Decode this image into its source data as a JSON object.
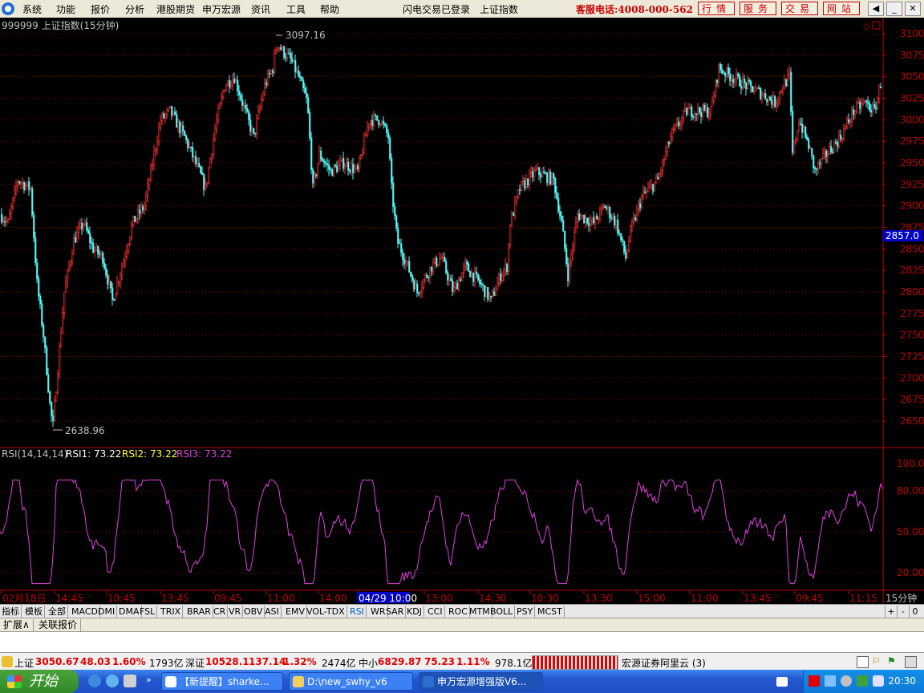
{
  "menu": {
    "items": [
      "系统",
      "功能",
      "报价",
      "分析",
      "港股期货",
      "申万宏源",
      "资讯",
      "工具",
      "帮助"
    ],
    "status_login": "闪电交易已登录",
    "status_index": "上证指数",
    "hotline": "客服电话:4008-000-562",
    "buttons": [
      "行情",
      "服务",
      "交易",
      "网站"
    ]
  },
  "main_chart": {
    "title": "999999 上证指数(15分钟)",
    "max_label": "3097.16",
    "min_label": "2638.96",
    "current_price": "2857.0",
    "y_ticks": [
      3100,
      3075,
      3050,
      3025,
      3000,
      2975,
      2950,
      2925,
      2900,
      2875,
      2850,
      2825,
      2800,
      2775,
      2750,
      2725,
      2700,
      2675,
      2650
    ]
  },
  "rsi": {
    "label": "RSI(14,14,14)",
    "rsi1": "RSI1: 73.22",
    "rsi2": "RSI2: 73.22",
    "rsi3": "RSI3: 73.22",
    "y_ticks": [
      "100.00",
      "80.00",
      "50.00",
      "20.00"
    ]
  },
  "time_axis": {
    "labels": [
      "02月18日",
      "14:45",
      "10:45",
      "13:45",
      "09:45",
      "11:00",
      "14:00",
      "04/29 10:00",
      "13:00",
      "14:30",
      "10:30",
      "13:30",
      "15:00",
      "11:00",
      "13:45",
      "09:45",
      "11:15"
    ],
    "period": "15分钟"
  },
  "indicator_tabs": [
    "指标",
    "模板",
    "全部",
    "MACD",
    "DMI",
    "DMA",
    "FSL",
    "TRIX",
    "BRAR",
    "CR",
    "VR",
    "OBV",
    "ASI",
    "EMV",
    "VOL-TDX",
    "RSI",
    "WR",
    "SAR",
    "KDJ",
    "CCI",
    "ROC",
    "MTM",
    "BOLL",
    "PSY",
    "MCST"
  ],
  "active_indicator": "RSI",
  "zoom_controls": [
    "+",
    "-",
    "0"
  ],
  "sub_tabs": [
    "扩展∧",
    "关联报价"
  ],
  "quotes": {
    "sh_label": "上证",
    "sh_price": "3050.67",
    "sh_change": "48.03",
    "sh_pct": "1.60%",
    "sh_vol": "1793亿",
    "sz_label": "深证",
    "sz_price": "10528.1",
    "sz_change": "137.14",
    "sz_pct": "1.32%",
    "sz_vol": "2474亿",
    "zx_label": "中小",
    "zx_price": "6829.87",
    "zx_change": "75.23",
    "zx_pct": "1.11%",
    "zx_vol": "978.1亿",
    "broker": "宏源证券阿里云 (3)"
  },
  "taskbar": {
    "start": "开始",
    "tasks": [
      "【新提醒】sharke...",
      "D:\\new_swhy_v6",
      "申万宏源增强版V6..."
    ],
    "clock": "20:30"
  },
  "colors": {
    "up_candle": "#ff3232",
    "down_candle": "#54fcfc",
    "rsi_line": "#e040e0",
    "axis_red": "#c00000",
    "grid": "#8b0000"
  }
}
